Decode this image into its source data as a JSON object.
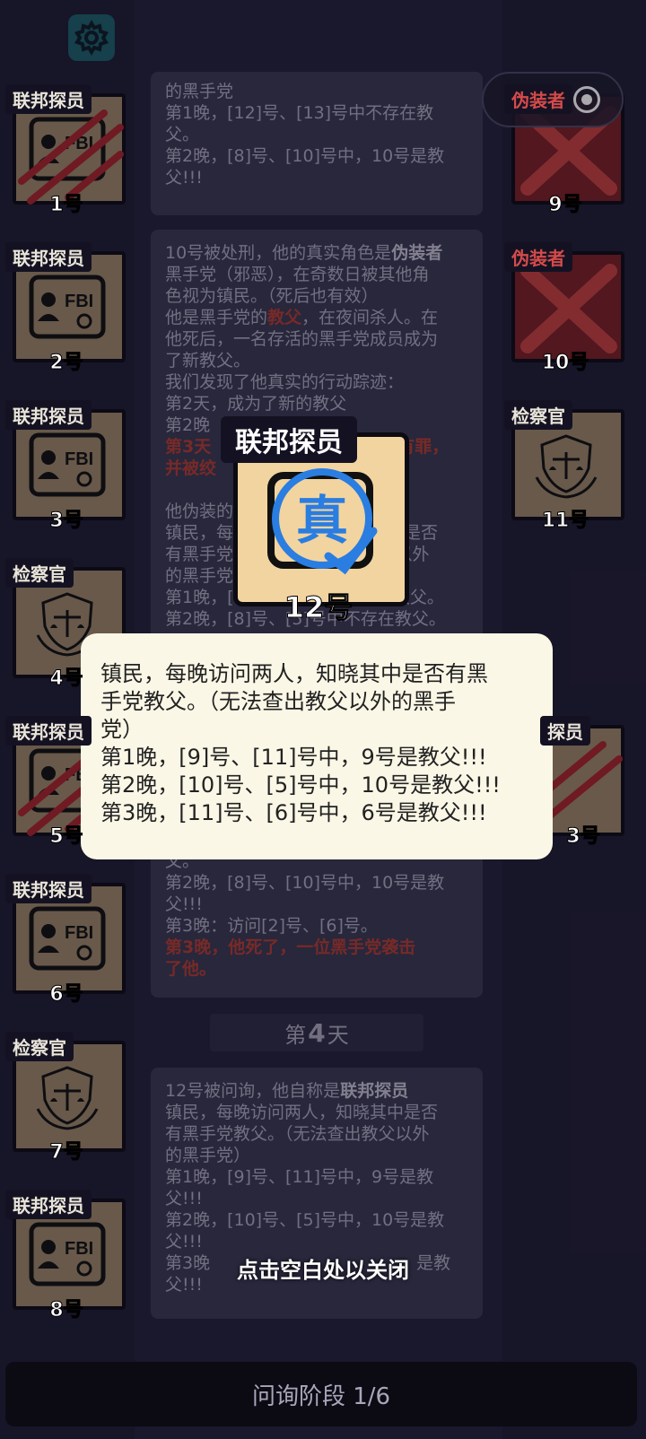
{
  "players": {
    "p1": {
      "role": "联邦探员",
      "num": "1号"
    },
    "p2": {
      "role": "联邦探员",
      "num": "2号"
    },
    "p3": {
      "role": "联邦探员",
      "num": "3号"
    },
    "p4": {
      "role": "检察官",
      "num": "4号"
    },
    "p5": {
      "role": "联邦探员",
      "num": "5号"
    },
    "p6": {
      "role": "联邦探员",
      "num": "6号"
    },
    "p7": {
      "role": "检察官",
      "num": "7号"
    },
    "p8": {
      "role": "联邦探员",
      "num": "8号"
    },
    "p9": {
      "role": "伪装者",
      "num": "9号"
    },
    "p10": {
      "role": "伪装者",
      "num": "10号"
    },
    "p11": {
      "role": "检察官",
      "num": "11号"
    },
    "p13": {
      "role": "探员",
      "num": "3号"
    }
  },
  "log": {
    "entry1": {
      "line1": "的黑手党",
      "line2": "第1晚，[12]号、[13]号中不存在教",
      "line3": "父。",
      "line4": "第2晚，[8]号、[10]号中，10号是教",
      "line5": "父!!!"
    },
    "entry2": {
      "l1a": "10号被处刑，他的真实角色是",
      "l1b": "伪装者",
      "l2": "黑手党（邪恶），在奇数日被其他角",
      "l3": "色视为镇民。（死后也有效）",
      "l4a": "他是黑手党的",
      "l4b": "教父",
      "l4c": "，在夜间杀人。在",
      "l5": "他死后，一名存活的黑手党成员成为",
      "l6": "了新教父。",
      "l7": "我们发现了他真实的行动踪迹：",
      "l8": "第2天，成为了新的教父",
      "l9": "第2晚",
      "l10": "第3天",
      "l10b": "有罪，",
      "l11": "并被绞",
      "l12": "他伪装的",
      "l13": "镇民，每晚访问两人，知晓其中是否",
      "l14": "有黑手党教父。（无法查出教父以外",
      "l15": "的黑手党）",
      "l16": "第1晚，[2]号、[?]号中不存在教父。",
      "l17": "第2晚，[8]号、[5]号中不存在教父。"
    },
    "entry3": {
      "l1": "父。",
      "l2": "第2晚，[8]号、[10]号中，10号是教",
      "l3": "父!!!",
      "l4": "第3晚：访问[2]号、[6]号。",
      "l5": "第3晚，他死了，一位黑手党袭击",
      "l6": "了他。"
    },
    "day4": {
      "pre": "第",
      "num": "4",
      "post": "天"
    },
    "entry4": {
      "l1a": "12号被问询，他自称是",
      "l1b": "联邦探员",
      "l2": "镇民，每晚访问两人，知晓其中是否",
      "l3": "有黑手党教父。（无法查出教父以外",
      "l4": "的黑手党）",
      "l5": "第1晚，[9]号、[11]号中，9号是教",
      "l6": "父!!!",
      "l7": "第2晚，[10]号、[5]号中，10号是教",
      "l8": "父!!!",
      "l9": "第3晚",
      "l9b": "是教",
      "l10": "父!!!"
    }
  },
  "popup": {
    "role": "联邦探员",
    "num": "12号",
    "stamp": "真"
  },
  "tooltip": {
    "l1": "镇民，每晚访问两人，知晓其中是否有黑",
    "l2": "手党教父。（无法查出教父以外的黑手",
    "l3": "党）",
    "l4": "第1晚，[9]号、[11]号中，9号是教父!!!",
    "l5": "第2晚，[10]号、[5]号中，10号是教父!!!",
    "l6": "第3晚，[11]号、[6]号中，6号是教父!!!"
  },
  "hint": "点击空白处以关闭",
  "phase": "问询阶段 1/6",
  "colors": {
    "background": "#23213a",
    "red_text": "#b23c32",
    "stamp_blue": "#2a7de1"
  }
}
